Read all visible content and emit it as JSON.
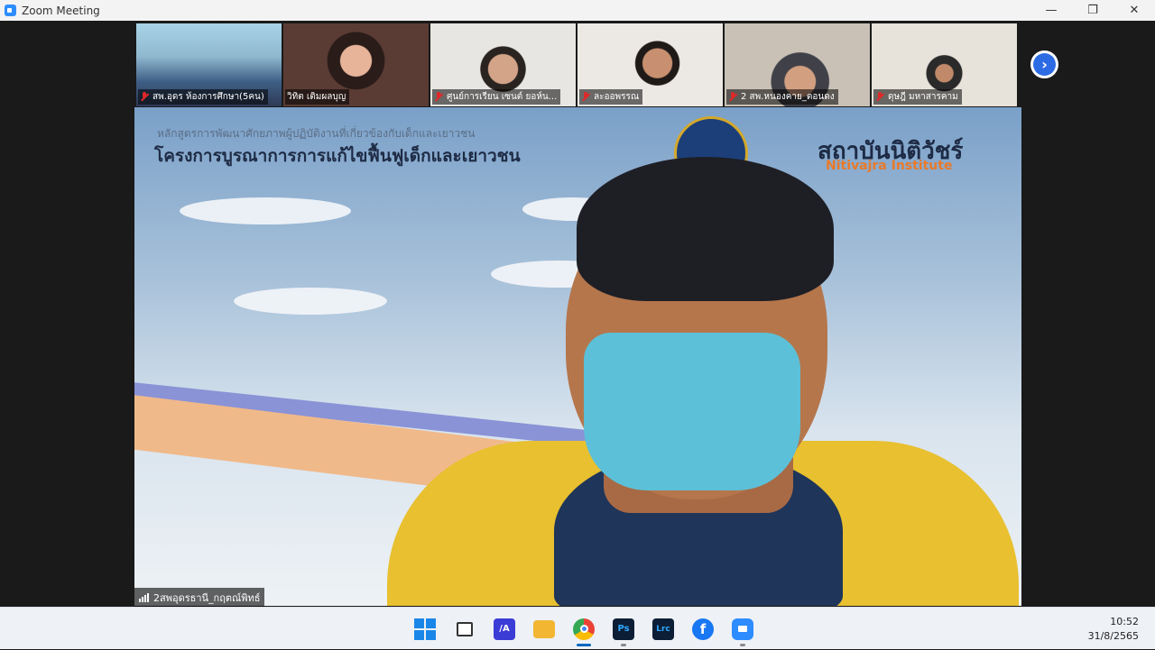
{
  "window": {
    "title": "Zoom Meeting",
    "controls": {
      "minimize": "—",
      "maximize": "❐",
      "close": "✕"
    }
  },
  "gallery": {
    "participants": [
      {
        "name": "สพ.อุดร ห้องการศึกษา(5คน)",
        "muted": true
      },
      {
        "name": "วิทิต เติมผลบุญ",
        "muted": false
      },
      {
        "name": "ศูนย์การเรียน เซนต์ ยอห์น...",
        "muted": true
      },
      {
        "name": "ละออพรรณ",
        "muted": true
      },
      {
        "name": "2 สพ.หนองคาย_ตอนดง",
        "muted": true
      },
      {
        "name": "ดุษฎี มหาสารคาม",
        "muted": true
      }
    ],
    "next_icon": "chevron-right-icon",
    "next_label": "›"
  },
  "speaker": {
    "name": "2สพอุดรธานี_กฤตณ์พิทธ์",
    "slide": {
      "line1": "หลักสูตรการพัฒนาศักยภาพผู้ปฏิบัติงานที่เกี่ยวข้องกับเด็กและเยาวชน",
      "line2": "โครงการบูรณาการการแก้ไขฟื้นฟูเด็กและเยาวชน",
      "logo_th": "สถาบันนิติวัชร์",
      "logo_en": "Nitivajra Institute"
    }
  },
  "taskbar": {
    "apps": [
      {
        "id": "start",
        "label": "",
        "icon": "windows-logo-icon"
      },
      {
        "id": "task-view",
        "label": "",
        "icon": "task-view-icon"
      },
      {
        "id": "app-ai",
        "label": "/A",
        "icon": "app-icon",
        "color": "#3b3bd6"
      },
      {
        "id": "explorer",
        "label": "",
        "icon": "folder-icon",
        "color": "#f2b632"
      },
      {
        "id": "chrome",
        "label": "",
        "icon": "chrome-icon",
        "active": true
      },
      {
        "id": "photoshop",
        "label": "Ps",
        "icon": "photoshop-icon",
        "color": "#0b1e36"
      },
      {
        "id": "lightroom",
        "label": "Lrc",
        "icon": "lightroom-icon",
        "color": "#0b1e36"
      },
      {
        "id": "facebook",
        "label": "f",
        "icon": "facebook-icon",
        "color": "#1877f2"
      },
      {
        "id": "zoom",
        "label": "",
        "icon": "zoom-icon",
        "color": "#2d8cff"
      }
    ],
    "time": "10:52",
    "date": "31/8/2565"
  },
  "colors": {
    "zoom_blue": "#2d8cff",
    "mute_red": "#e02828",
    "slide_orange": "#e87a2a"
  }
}
